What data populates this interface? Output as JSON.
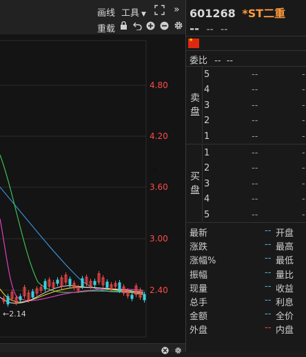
{
  "toolbar": {
    "draw_label": "画线",
    "tools_label": "工具",
    "reload_label": "重载"
  },
  "chart": {
    "y_ticks": [
      "4.80",
      "4.20",
      "3.60",
      "3.00",
      "2.40"
    ],
    "low_marker": "←2.14",
    "colors": {
      "price_up": "#ff4a4a",
      "ma_blue": "#3a8fd8",
      "ma_green": "#3fbf55",
      "ma_magenta": "#e040c0",
      "ma_white": "#e8e8e8",
      "ma_yellow": "#e8c830"
    }
  },
  "stock": {
    "code": "601268",
    "name": "*ST二重",
    "price": "--",
    "change": "--",
    "change_pct": "--"
  },
  "order_book": {
    "ratio_label": "委比",
    "ratio_value": "--",
    "ratio_value2": "--",
    "sell_label_1": "卖",
    "sell_label_2": "盘",
    "buy_label_1": "买",
    "buy_label_2": "盘",
    "sell": [
      {
        "level": "5",
        "price": "--",
        "vol": "-"
      },
      {
        "level": "4",
        "price": "--",
        "vol": "-"
      },
      {
        "level": "3",
        "price": "--",
        "vol": "-"
      },
      {
        "level": "2",
        "price": "--",
        "vol": "-"
      },
      {
        "level": "1",
        "price": "--",
        "vol": "-"
      }
    ],
    "buy": [
      {
        "level": "1",
        "price": "--",
        "vol": "-"
      },
      {
        "level": "2",
        "price": "--",
        "vol": "-"
      },
      {
        "level": "3",
        "price": "--",
        "vol": "-"
      },
      {
        "level": "4",
        "price": "--",
        "vol": "-"
      },
      {
        "level": "5",
        "price": "--",
        "vol": "-"
      }
    ]
  },
  "stats": [
    {
      "label": "最新",
      "value": "--",
      "label2": "开盘"
    },
    {
      "label": "涨跌",
      "value": "--",
      "label2": "最高"
    },
    {
      "label": "涨幅%",
      "value": "--",
      "label2": "最低"
    },
    {
      "label": "振幅",
      "value": "--",
      "label2": "量比"
    },
    {
      "label": "现量",
      "value": "--",
      "label2": "收益"
    },
    {
      "label": "总手",
      "value": "--",
      "label2": "利息"
    },
    {
      "label": "金额",
      "value": "--",
      "label2": "全价"
    },
    {
      "label": "外盘",
      "value": "--",
      "label2": "内盘"
    }
  ]
}
